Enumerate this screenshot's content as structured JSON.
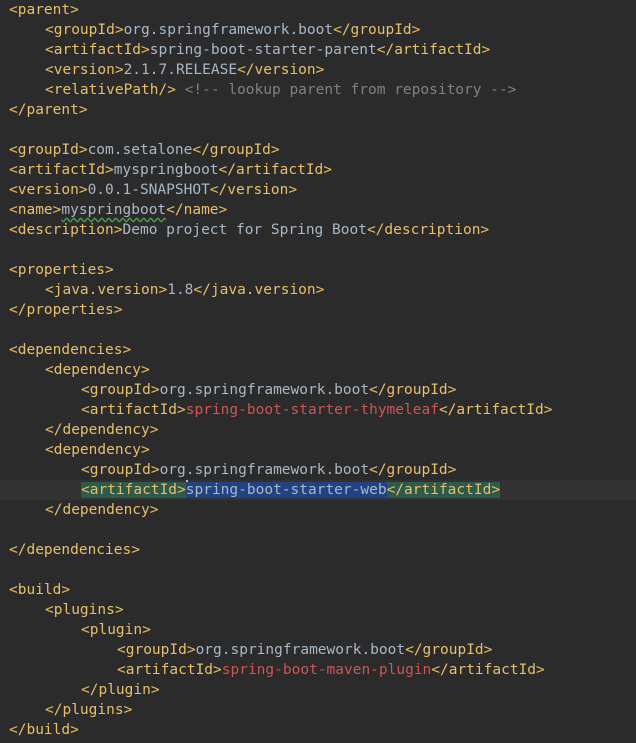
{
  "editor": {
    "lines": [
      {
        "i": 0,
        "parts": [
          {
            "t": "<parent>",
            "c": "tag"
          }
        ]
      },
      {
        "i": 1,
        "parts": [
          {
            "t": "<groupId>",
            "c": "tag"
          },
          {
            "t": "org.springframework.boot",
            "c": "text"
          },
          {
            "t": "</groupId>",
            "c": "tag"
          }
        ]
      },
      {
        "i": 1,
        "parts": [
          {
            "t": "<artifactId>",
            "c": "tag"
          },
          {
            "t": "spring-boot-starter-parent",
            "c": "text"
          },
          {
            "t": "</artifactId>",
            "c": "tag"
          }
        ]
      },
      {
        "i": 1,
        "parts": [
          {
            "t": "<version>",
            "c": "tag"
          },
          {
            "t": "2.1.7.RELEASE",
            "c": "text"
          },
          {
            "t": "</version>",
            "c": "tag"
          }
        ]
      },
      {
        "i": 1,
        "parts": [
          {
            "t": "<relativePath/>",
            "c": "tag"
          },
          {
            "t": " <!-- lookup parent from repository -->",
            "c": "cmt"
          }
        ]
      },
      {
        "i": 0,
        "parts": [
          {
            "t": "</parent>",
            "c": "tag"
          }
        ]
      },
      {
        "i": 0,
        "parts": []
      },
      {
        "i": 0,
        "parts": [
          {
            "t": "<groupId>",
            "c": "tag"
          },
          {
            "t": "com.setalone",
            "c": "text"
          },
          {
            "t": "</groupId>",
            "c": "tag"
          }
        ]
      },
      {
        "i": 0,
        "parts": [
          {
            "t": "<artifactId>",
            "c": "tag"
          },
          {
            "t": "myspringboot",
            "c": "text"
          },
          {
            "t": "</artifactId>",
            "c": "tag"
          }
        ]
      },
      {
        "i": 0,
        "parts": [
          {
            "t": "<version>",
            "c": "tag"
          },
          {
            "t": "0.0.1-SNAPSHOT",
            "c": "text"
          },
          {
            "t": "</version>",
            "c": "tag"
          }
        ]
      },
      {
        "i": 0,
        "parts": [
          {
            "t": "<name>",
            "c": "tag"
          },
          {
            "t": "myspringboot",
            "c": "text typo"
          },
          {
            "t": "</name>",
            "c": "tag"
          }
        ]
      },
      {
        "i": 0,
        "parts": [
          {
            "t": "<description>",
            "c": "tag"
          },
          {
            "t": "Demo project for Spring Boot",
            "c": "text"
          },
          {
            "t": "</description>",
            "c": "tag"
          }
        ]
      },
      {
        "i": 0,
        "parts": []
      },
      {
        "i": 0,
        "parts": [
          {
            "t": "<properties>",
            "c": "tag"
          }
        ]
      },
      {
        "i": 1,
        "parts": [
          {
            "t": "<java.version>",
            "c": "tag"
          },
          {
            "t": "1.8",
            "c": "text"
          },
          {
            "t": "</java.version>",
            "c": "tag"
          }
        ]
      },
      {
        "i": 0,
        "parts": [
          {
            "t": "</properties>",
            "c": "tag"
          }
        ]
      },
      {
        "i": 0,
        "parts": []
      },
      {
        "i": 0,
        "parts": [
          {
            "t": "<dependencies>",
            "c": "tag"
          }
        ]
      },
      {
        "i": 1,
        "parts": [
          {
            "t": "<dependency>",
            "c": "tag"
          }
        ]
      },
      {
        "i": 2,
        "parts": [
          {
            "t": "<groupId>",
            "c": "tag"
          },
          {
            "t": "org.springframework.boot",
            "c": "text"
          },
          {
            "t": "</groupId>",
            "c": "tag"
          }
        ]
      },
      {
        "i": 2,
        "parts": [
          {
            "t": "<artifactId>",
            "c": "tag"
          },
          {
            "t": "spring-boot-starter-thymeleaf",
            "c": "red"
          },
          {
            "t": "</artifactId>",
            "c": "tag"
          }
        ]
      },
      {
        "i": 1,
        "parts": [
          {
            "t": "</dependency>",
            "c": "tag"
          }
        ]
      },
      {
        "i": 1,
        "parts": [
          {
            "t": "<dependency>",
            "c": "tag"
          }
        ]
      },
      {
        "i": 2,
        "parts": [
          {
            "t": "<groupId>",
            "c": "tag"
          },
          {
            "t": "org.springframework.boot",
            "c": "text"
          },
          {
            "t": "</groupId>",
            "c": "tag"
          }
        ]
      },
      {
        "i": 2,
        "current": true,
        "parts": [
          {
            "t": "<artifactId>",
            "c": "tag hl-tag"
          },
          {
            "caret": true
          },
          {
            "t": "spring-boot-starter-web",
            "c": "hl-text"
          },
          {
            "t": "</artifactId>",
            "c": "tag hl-tag"
          }
        ]
      },
      {
        "i": 1,
        "parts": [
          {
            "t": "</dependency>",
            "c": "tag"
          }
        ]
      },
      {
        "i": 0,
        "parts": []
      },
      {
        "i": 0,
        "parts": [
          {
            "t": "</dependencies>",
            "c": "tag"
          }
        ]
      },
      {
        "i": 0,
        "parts": []
      },
      {
        "i": 0,
        "parts": [
          {
            "t": "<build>",
            "c": "tag"
          }
        ]
      },
      {
        "i": 1,
        "parts": [
          {
            "t": "<plugins>",
            "c": "tag"
          }
        ]
      },
      {
        "i": 2,
        "parts": [
          {
            "t": "<plugin>",
            "c": "tag"
          }
        ]
      },
      {
        "i": 3,
        "parts": [
          {
            "t": "<groupId>",
            "c": "tag"
          },
          {
            "t": "org.springframework.boot",
            "c": "text"
          },
          {
            "t": "</groupId>",
            "c": "tag"
          }
        ]
      },
      {
        "i": 3,
        "parts": [
          {
            "t": "<artifactId>",
            "c": "tag"
          },
          {
            "t": "spring-boot-maven-plugin",
            "c": "red"
          },
          {
            "t": "</artifactId>",
            "c": "tag"
          }
        ]
      },
      {
        "i": 2,
        "parts": [
          {
            "t": "</plugin>",
            "c": "tag"
          }
        ]
      },
      {
        "i": 1,
        "parts": [
          {
            "t": "</plugins>",
            "c": "tag"
          }
        ]
      },
      {
        "i": 0,
        "parts": [
          {
            "t": "</build>",
            "c": "tag"
          }
        ]
      }
    ]
  }
}
